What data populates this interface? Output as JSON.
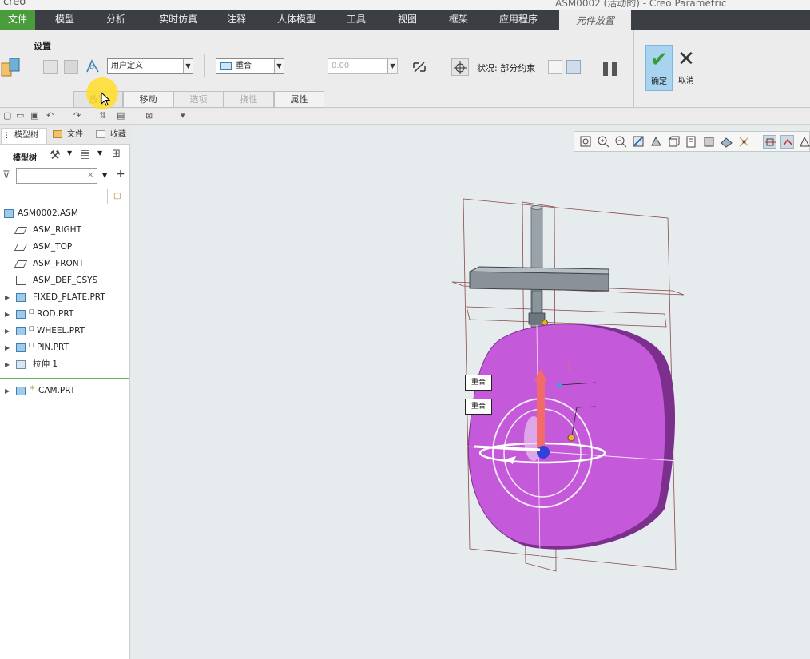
{
  "window": {
    "app_name": "creo",
    "title": "ASM0002 (活动的) - Creo Parametric"
  },
  "menubar": {
    "items": [
      "文件",
      "模型",
      "分析",
      "实时仿真",
      "注释",
      "人体模型",
      "工具",
      "视图",
      "框架",
      "应用程序",
      "元件放置"
    ]
  },
  "ribbon": {
    "group_label": "设置",
    "constraint_set_value": "用户定义",
    "constraint_type_value": "重合",
    "offset_value": "0.00",
    "status_text": "状况: 部分约束",
    "ok_label": "确定",
    "cancel_label": "取消",
    "tabs": [
      "放置",
      "移动",
      "选项",
      "挠性",
      "属性"
    ]
  },
  "model_tree": {
    "tabs": [
      "模型树",
      "文件",
      "收藏"
    ],
    "tree_label": "模型树",
    "items": [
      {
        "label": "ASM0002.ASM",
        "icon": "assembly-icon",
        "expandable": false
      },
      {
        "label": "ASM_RIGHT",
        "icon": "datum-plane-icon",
        "expandable": false
      },
      {
        "label": "ASM_TOP",
        "icon": "datum-plane-icon",
        "expandable": false
      },
      {
        "label": "ASM_FRONT",
        "icon": "datum-plane-icon",
        "expandable": false
      },
      {
        "label": "ASM_DEF_CSYS",
        "icon": "csys-icon",
        "expandable": false
      },
      {
        "label": "FIXED_PLATE.PRT",
        "icon": "part-icon",
        "expandable": true
      },
      {
        "label": "ROD.PRT",
        "icon": "part-icon",
        "expandable": true
      },
      {
        "label": "WHEEL.PRT",
        "icon": "part-icon",
        "expandable": true
      },
      {
        "label": "PIN.PRT",
        "icon": "part-icon",
        "expandable": true
      },
      {
        "label": "拉伸 1",
        "icon": "extrude-icon",
        "expandable": true
      },
      {
        "label": "CAM.PRT",
        "icon": "part-icon",
        "expandable": true
      }
    ]
  },
  "viewport": {
    "constraint_tags": [
      "重合",
      "重合"
    ],
    "colors": {
      "cam": "#c45ad9",
      "plate": "#8a9198",
      "rod": "#9aa3aa"
    }
  }
}
